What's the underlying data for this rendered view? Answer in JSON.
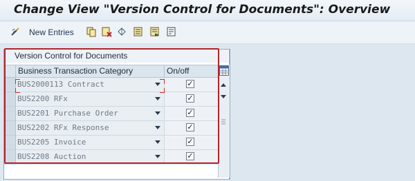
{
  "window": {
    "title": "Change View \"Version Control for Documents\": Overview"
  },
  "toolbar": {
    "new_entries_label": "New Entries",
    "icons": [
      "new-entries-icon",
      "copy-icon",
      "delete-icon",
      "undo-icon",
      "select-all-icon",
      "select-block-icon",
      "deselect-all-icon"
    ]
  },
  "table": {
    "title": "Version Control for Documents",
    "columns": [
      "Business Transaction Category",
      "On/off"
    ],
    "rows": [
      {
        "category": "BUS2000113 Contract",
        "on": true
      },
      {
        "category": "BUS2200 RFx",
        "on": true
      },
      {
        "category": "BUS2201 Purchase Order",
        "on": true
      },
      {
        "category": "BUS2202 RFx Response",
        "on": true
      },
      {
        "category": "BUS2205 Invoice",
        "on": true
      },
      {
        "category": "BUS2208 Auction",
        "on": true
      }
    ],
    "checkmark": "✓"
  },
  "colors": {
    "highlight": "#b3232b",
    "focus_bracket": "#d22a2a"
  }
}
